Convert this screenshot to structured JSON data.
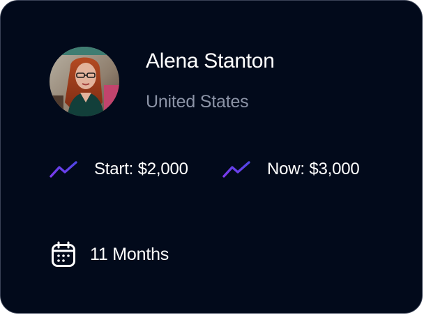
{
  "profile": {
    "name": "Alena Stanton",
    "location": "United States",
    "avatar_alt": "profile photo"
  },
  "stats": {
    "start_label": "Start: $2,000",
    "now_label": "Now: $3,000",
    "trend_icon": "trending-up-icon"
  },
  "duration": {
    "label": "11 Months",
    "icon": "calendar-icon"
  },
  "colors": {
    "card_background": "#020a1b",
    "card_border": "#3a4256",
    "primary_text": "#ffffff",
    "secondary_text": "#8b93a6",
    "trend_gradient_start": "#7c3aed",
    "trend_gradient_end": "#4f46e5"
  }
}
